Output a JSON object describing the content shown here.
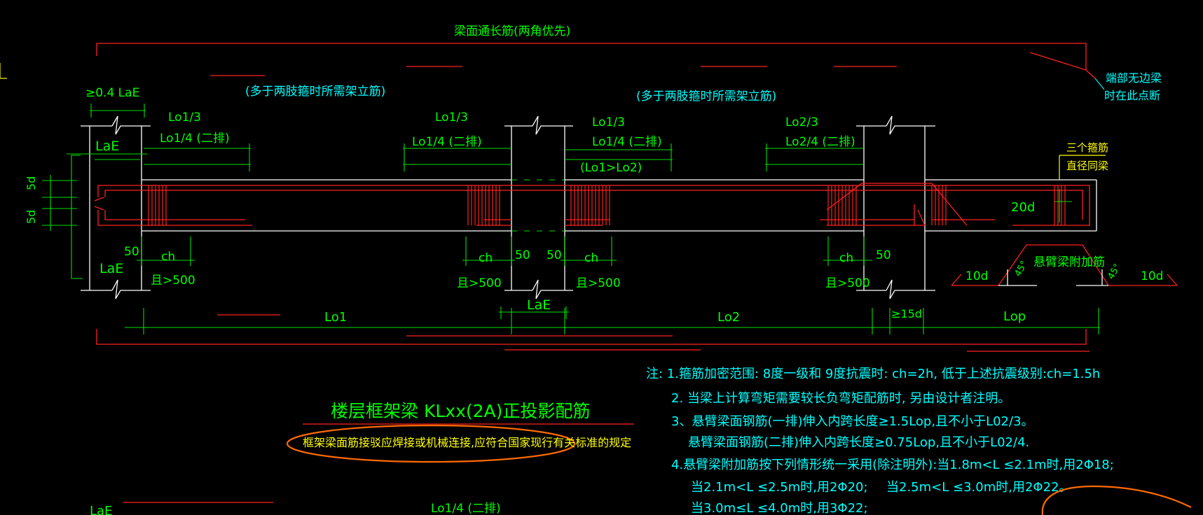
{
  "top_bar_label": "梁面通长筋(两角优先)",
  "erection_bar_note_left": "(多于两肢箍时所需架立筋)",
  "erection_bar_note_right": "(多于两肢箍时所需架立筋)",
  "end_note_line1": "端部无边梁",
  "end_note_line2": "时在此点断",
  "anchor_04lae": "≥0.4 LaE",
  "l01_third": "Lo1/3",
  "l01_quarter_left": "Lo1/4 (二排)",
  "l01_third_mid": "Lo1/3",
  "l01_quarter_mid": "Lo1/4 (二排)",
  "l01_third_b": "Lo1/3",
  "l01_quarter_b": "Lo1/4 (二排)",
  "lo1_gt_lo2": "(Lo1>Lo2)",
  "l02_third": "Lo2/3",
  "l02_quarter": "Lo2/4 (二排)",
  "lae_top": "LaE",
  "lae_bottom": "LaE",
  "lae_mid": "LaE",
  "lae_cut": "LaE",
  "five_d_1": "5d",
  "five_d_2": "5d",
  "three_stirrup_1": "三个箍筋",
  "three_stirrup_2": "直径同梁",
  "twenty_d": "20d",
  "cantilever_extra": "悬臂梁附加筋",
  "ten_d_left": "10d",
  "ten_d_right": "10d",
  "angle_45_left": "45°",
  "angle_45_right": "45°",
  "dim_50_1": "50",
  "dim_50_2": "50",
  "dim_50_3": "50",
  "dim_50_4": "50",
  "ch_1": "ch",
  "ch_2": "ch",
  "ch_3": "ch",
  "ch_4": "ch",
  "gt500_1": "且>500",
  "gt500_2": "且>500",
  "gt500_3": "且>500",
  "gt500_4": "且>500",
  "span_l01": "Lo1",
  "span_l02": "Lo2",
  "span_lop": "Lop",
  "span_15d": "≥15d",
  "title": "楼层框架梁 KLxx(2A)正投影配筋",
  "subtitle": "框架梁面筋接驳应焊接或机械连接,应符合国家现行有关标准的规定",
  "notes": [
    "注: 1.箍筋加密范围: 8度一级和 9度抗震时: ch=2h, 低于上述抗震级别:ch=1.5h",
    "2. 当梁上计算弯矩需要较长负弯矩配筋时, 另由设计者注明。",
    "3、悬臂梁面钢筋(一排)伸入内跨长度≥1.5Lop,且不小于L02/3。",
    "悬臂梁面钢筋(二排)伸入内跨长度≥0.75Lop,且不小于L02/4.",
    "4.悬臂梁附加筋按下列情形统一采用(除注明外):当1.8m<L ≤2.1m时,用2Φ18;",
    "当2.1m<L ≤2.5m时,用2Φ20;",
    "当2.5m<L ≤3.0m时,用2Φ22。",
    "当3.0m≤L ≤4.0m时,用3Φ22;"
  ],
  "bottom_lae_fragment": "LaE",
  "bottom_quarter_fragment": "Lo1/4 (二排)",
  "colors": {
    "background": "#000000",
    "rebar": "#ff2020",
    "dimension": "#00ff00",
    "concrete": "#ffffff",
    "annotation": "#00ffff",
    "highlight": "#ffff00",
    "markup": "#ff6a00"
  }
}
